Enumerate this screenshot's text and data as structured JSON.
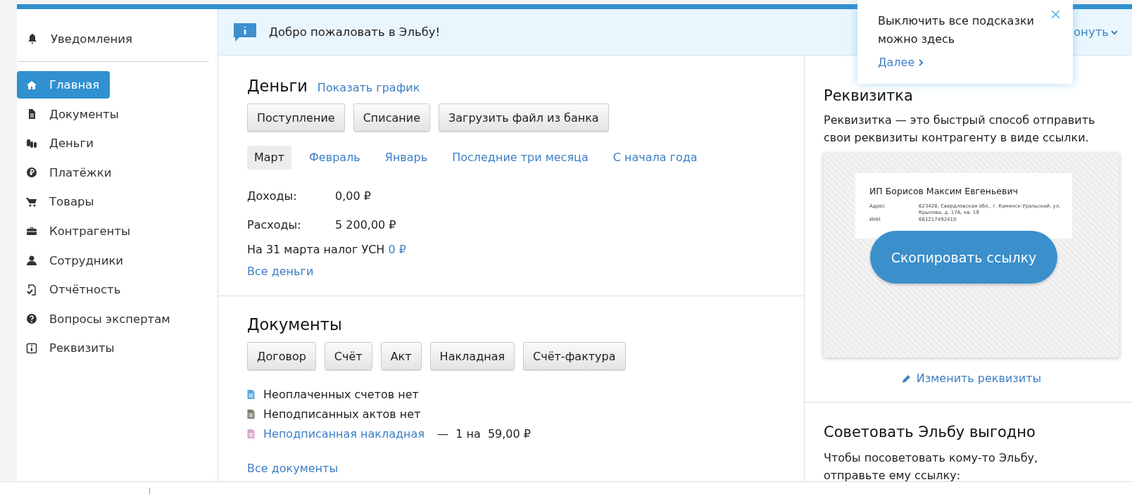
{
  "sidebar": {
    "notifications": "Уведомления",
    "items": [
      {
        "label": "Главная",
        "selected": true
      },
      {
        "label": "Документы",
        "selected": false
      },
      {
        "label": "Деньги",
        "selected": false
      },
      {
        "label": "Платёжки",
        "selected": false
      },
      {
        "label": "Товары",
        "selected": false
      },
      {
        "label": "Контрагенты",
        "selected": false
      },
      {
        "label": "Сотрудники",
        "selected": false
      },
      {
        "label": "Отчётность",
        "selected": false
      },
      {
        "label": "Вопросы экспертам",
        "selected": false
      },
      {
        "label": "Реквизиты",
        "selected": false
      }
    ]
  },
  "banner": {
    "text": "Добро пожаловать в Эльбу!",
    "collapse": "онуть"
  },
  "tooltip": {
    "text": "Выключить все подсказки можно здесь",
    "next": "Далее"
  },
  "money": {
    "title": "Деньги",
    "chart_link": "Показать график",
    "buttons": [
      "Поступление",
      "Списание",
      "Загрузить файл из банка"
    ],
    "periods": [
      {
        "label": "Март",
        "selected": true
      },
      {
        "label": "Февраль",
        "selected": false
      },
      {
        "label": "Январь",
        "selected": false
      },
      {
        "label": "Последние три месяца",
        "selected": false
      },
      {
        "label": "С начала года",
        "selected": false
      }
    ],
    "rows": [
      {
        "label": "Доходы:",
        "value": "0,00 ₽"
      },
      {
        "label": "Расходы:",
        "value": "5 200,00 ₽"
      }
    ],
    "tax": {
      "text": "На 31 марта налог УСН",
      "amount": "0 ₽"
    },
    "all_link": "Все деньги"
  },
  "documents": {
    "title": "Документы",
    "buttons": [
      "Договор",
      "Счёт",
      "Акт",
      "Накладная",
      "Счёт-фактура"
    ],
    "items": [
      {
        "kind": "text",
        "text": "Неоплаченных счетов нет",
        "color": "#5aa9dc"
      },
      {
        "kind": "text",
        "text": "Неподписанных актов нет",
        "color": "#7d7d72"
      },
      {
        "kind": "link",
        "text": "Неподписанная накладная",
        "detail": "—  1 на  59,00 ₽",
        "color": "#dba6cc"
      }
    ],
    "all_link": "Все документы"
  },
  "card": {
    "title": "Реквизитка",
    "description": "Реквизитка — это быстрый способ отправить свои реквизиты контрагенту в виде ссылки.",
    "name": "ИП Борисов Максим Евгеньевич",
    "fields": [
      {
        "label": "Адрес",
        "value": "623428, Свердловская обл., г. Каменск-Уральский, ул. Крылова, д. 17А, кв. 19"
      },
      {
        "label": "ИНН",
        "value": "661217492410"
      }
    ],
    "copy_button": "Скопировать ссылку",
    "edit_link": "Изменить реквизиты"
  },
  "referral": {
    "title": "Советовать Эльбу выгодно",
    "text": "Чтобы посоветовать кому-то Эльбу, отправьте ему ссылку:"
  }
}
